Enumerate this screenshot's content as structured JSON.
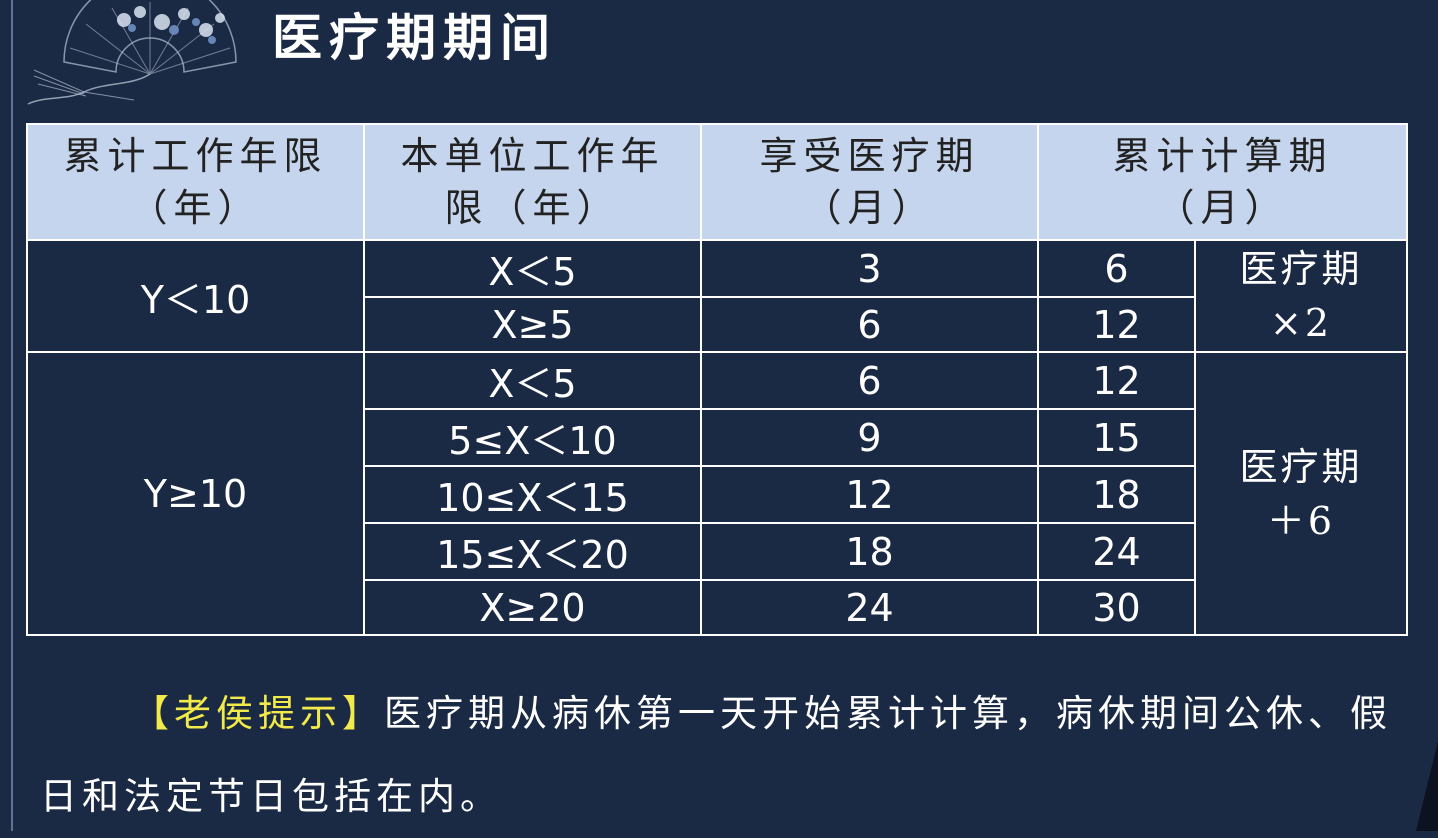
{
  "title": "医疗期期间",
  "table": {
    "headers": [
      [
        "累计工作年限",
        "（年）"
      ],
      [
        "本单位工作年",
        "限（年）"
      ],
      [
        "享受医疗期",
        "（月）"
      ],
      [
        "累计计算期",
        "（月）"
      ]
    ],
    "groups": [
      {
        "total_years": "Y＜10",
        "note": [
          "医疗期",
          "×2"
        ],
        "rows": [
          {
            "unit_years": "X＜5",
            "medical_months": "3",
            "cumulative_months": "6"
          },
          {
            "unit_years": "X≥5",
            "medical_months": "6",
            "cumulative_months": "12"
          }
        ]
      },
      {
        "total_years": "Y≥10",
        "note": [
          "医疗期",
          "＋6"
        ],
        "rows": [
          {
            "unit_years": "X＜5",
            "medical_months": "6",
            "cumulative_months": "12"
          },
          {
            "unit_years": "5≤X＜10",
            "medical_months": "9",
            "cumulative_months": "15"
          },
          {
            "unit_years": "10≤X＜15",
            "medical_months": "12",
            "cumulative_months": "18"
          },
          {
            "unit_years": "15≤X＜20",
            "medical_months": "18",
            "cumulative_months": "24"
          },
          {
            "unit_years": "X≥20",
            "medical_months": "24",
            "cumulative_months": "30"
          }
        ]
      }
    ]
  },
  "tip": {
    "label": "【老侯提示】",
    "text": "医疗期从病休第一天开始累计计算，病休期间公休、假日和法定节日包括在内。"
  },
  "colors": {
    "background": "#1b2a44",
    "header_fill": "#c6d5ee",
    "tip_label": "#f2e94a"
  }
}
